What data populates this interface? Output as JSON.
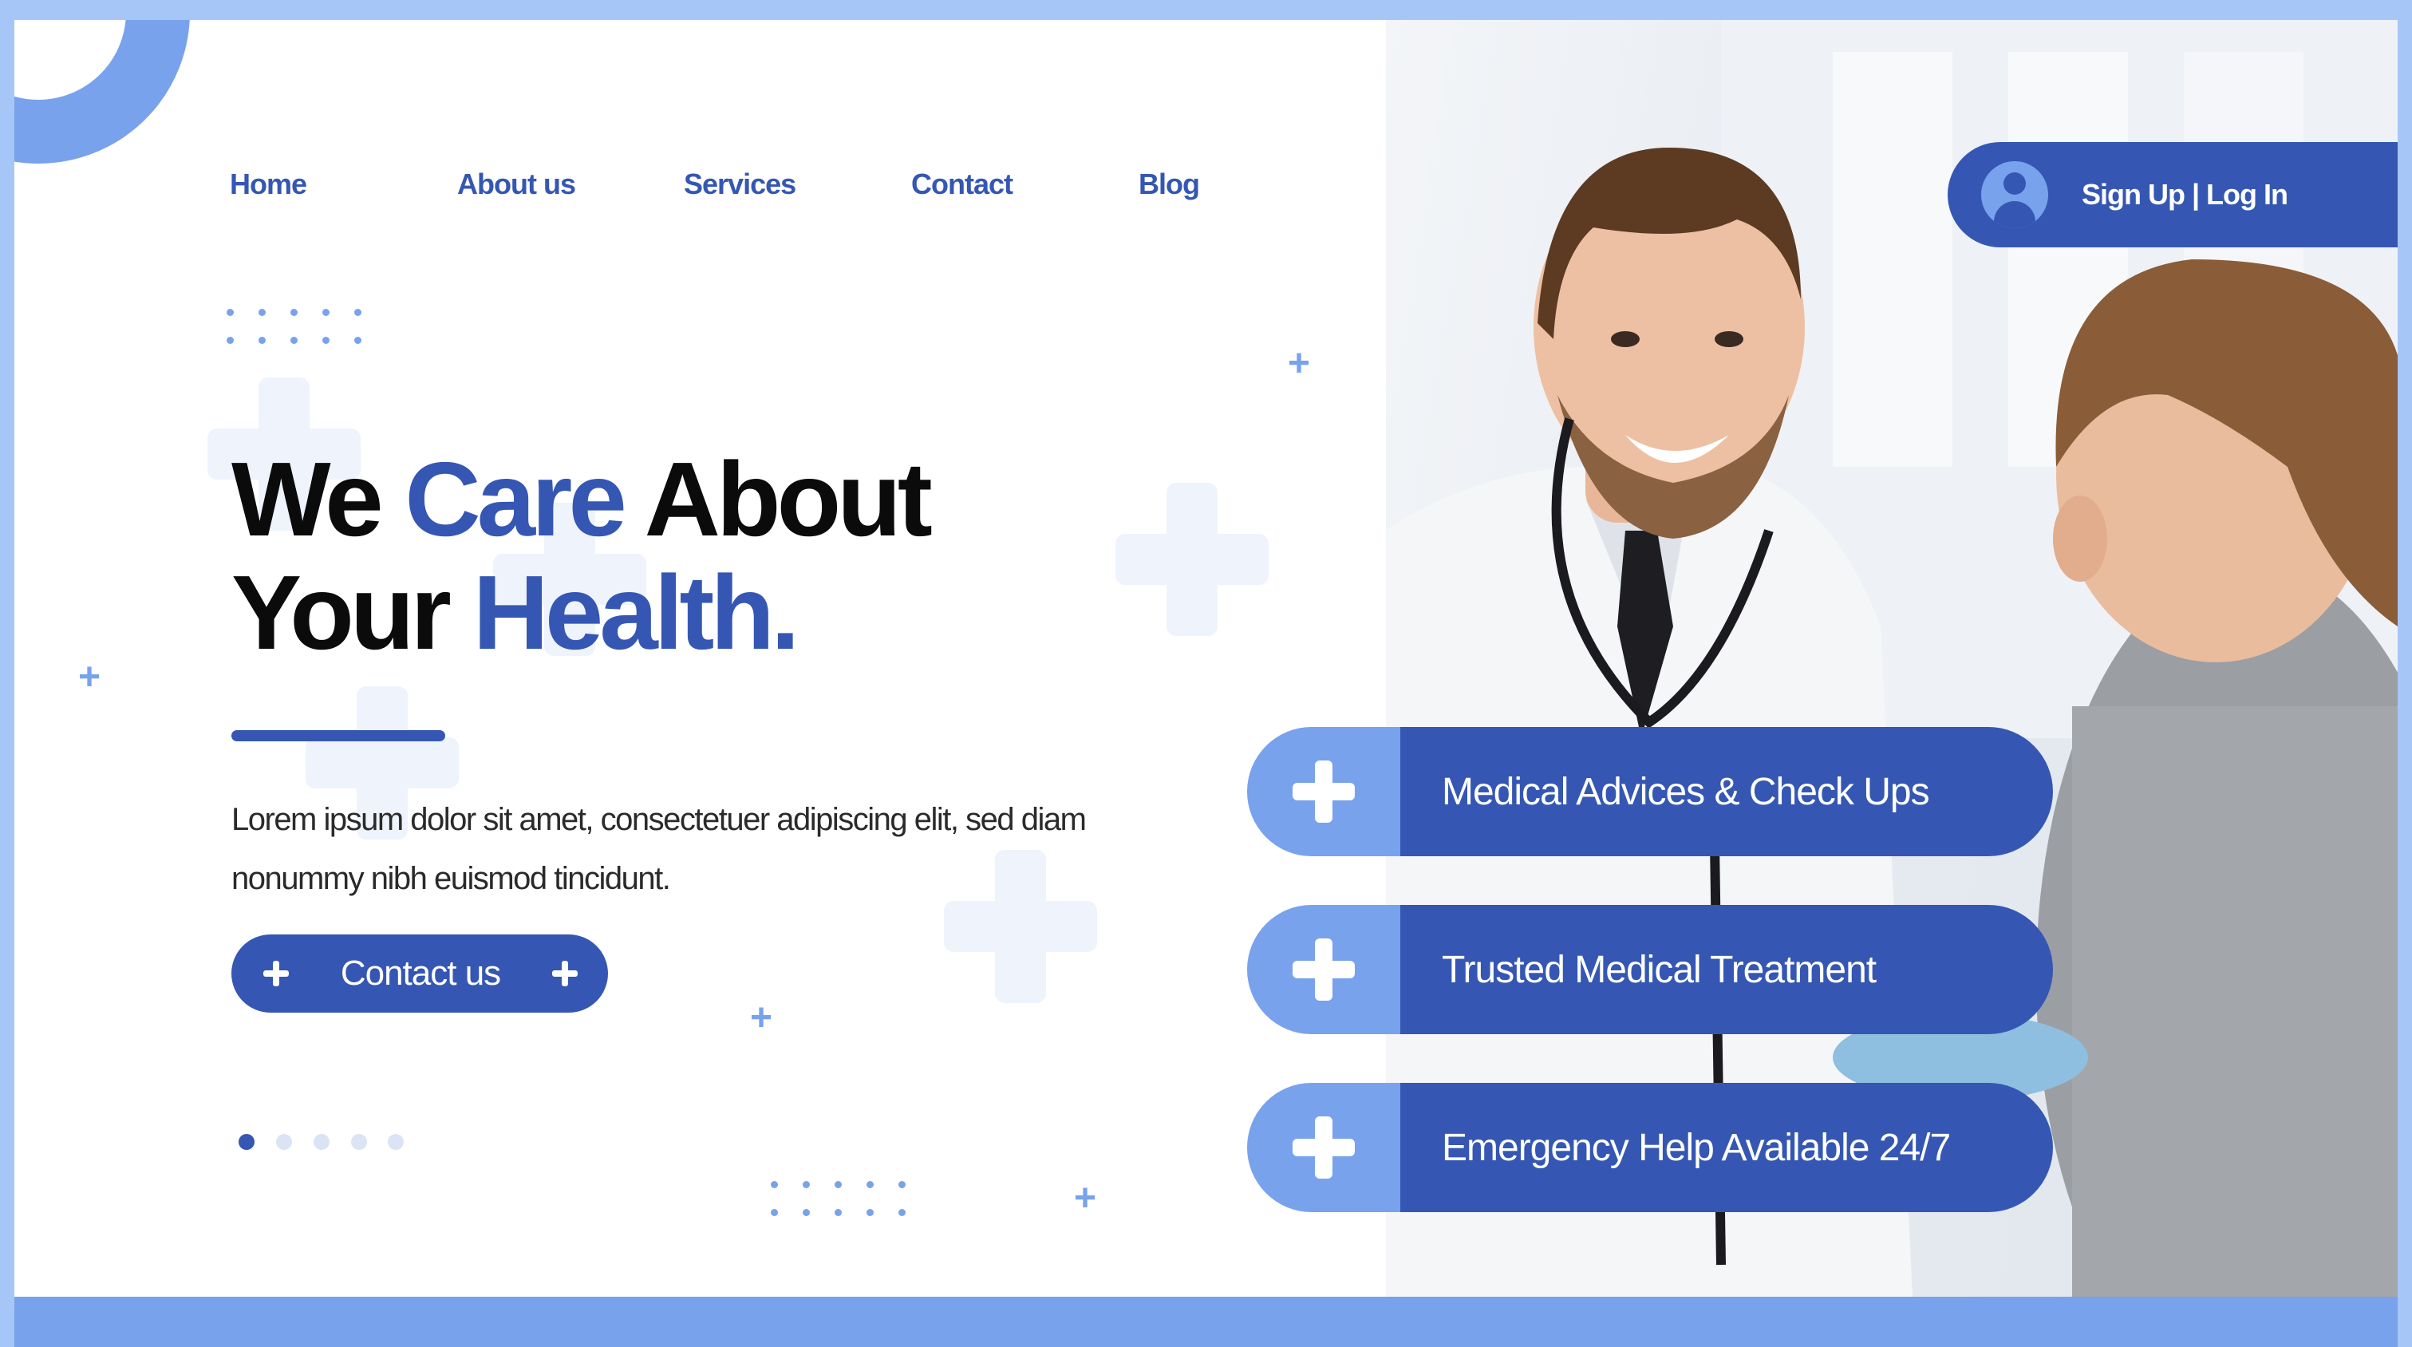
{
  "nav": {
    "items": [
      {
        "label": "Home"
      },
      {
        "label": "About us"
      },
      {
        "label": "Services"
      },
      {
        "label": "Contact"
      },
      {
        "label": "Blog"
      }
    ]
  },
  "auth": {
    "label": "Sign Up |  Log In",
    "icon": "user-icon"
  },
  "hero": {
    "title_word1": "We",
    "title_word2": "Care",
    "title_word3": "About",
    "title_word4": "Your",
    "title_word5": "Health.",
    "description": "Lorem ipsum dolor sit amet, consectetuer adipiscing elit, sed diam nonummy nibh euismod tincidunt.",
    "cta_label": "Contact us"
  },
  "features": [
    {
      "label": "Medical Advices & Check Ups",
      "icon": "plus-icon"
    },
    {
      "label": "Trusted Medical Treatment",
      "icon": "plus-icon"
    },
    {
      "label": "Emergency Help Available 24/7",
      "icon": "plus-icon"
    }
  ],
  "pager": {
    "total": 5,
    "active": 1
  },
  "colors": {
    "primary": "#3557b3",
    "accent": "#78a2ec",
    "frame": "#a6c6f7",
    "text_dark": "#0b0b0b"
  }
}
